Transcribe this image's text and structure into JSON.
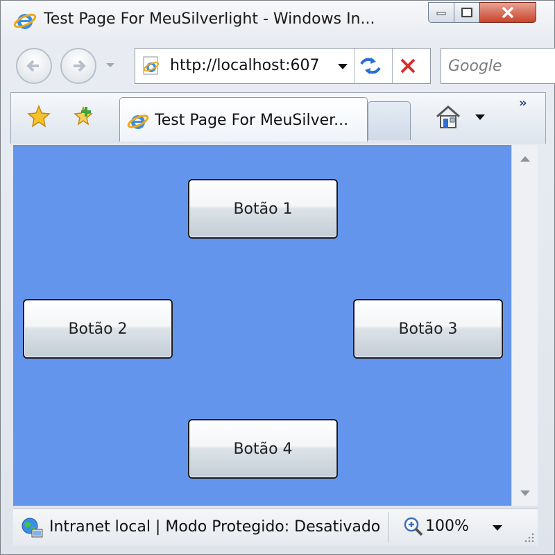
{
  "window": {
    "title": "Test Page For MeuSilverlight - Windows In...",
    "app_icon": "ie-icon"
  },
  "navigation": {
    "back_icon": "back-arrow-icon",
    "forward_icon": "forward-arrow-icon",
    "address_value": "http://localhost:607",
    "search_placeholder": "Google"
  },
  "tabs": {
    "items": [
      {
        "label": "Test Page For MeuSilver..."
      }
    ]
  },
  "content": {
    "background_color": "#6495ed",
    "buttons": [
      {
        "label": "Botão 1"
      },
      {
        "label": "Botão 2"
      },
      {
        "label": "Botão 3"
      },
      {
        "label": "Botão 4"
      }
    ]
  },
  "status_bar": {
    "zone_text": "Intranet local | Modo Protegido: Desativado",
    "zoom_text": "100%"
  }
}
